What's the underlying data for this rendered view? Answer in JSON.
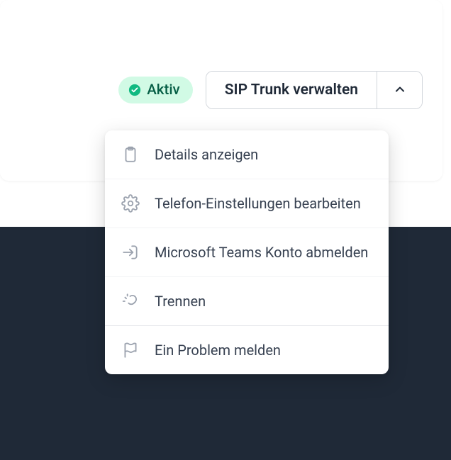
{
  "status": {
    "label": "Aktiv",
    "color": "#10b981"
  },
  "buttons": {
    "manage_label": "SIP Trunk verwalten"
  },
  "dropdown": {
    "items": [
      {
        "label": "Details anzeigen",
        "icon": "clipboard-icon"
      },
      {
        "label": "Telefon-Einstellungen bearbeiten",
        "icon": "gear-icon"
      },
      {
        "label": "Microsoft Teams Konto abmelden",
        "icon": "sign-out-icon"
      },
      {
        "label": "Trennen",
        "icon": "disconnect-icon"
      },
      {
        "label": "Ein Problem melden",
        "icon": "flag-icon"
      }
    ]
  }
}
